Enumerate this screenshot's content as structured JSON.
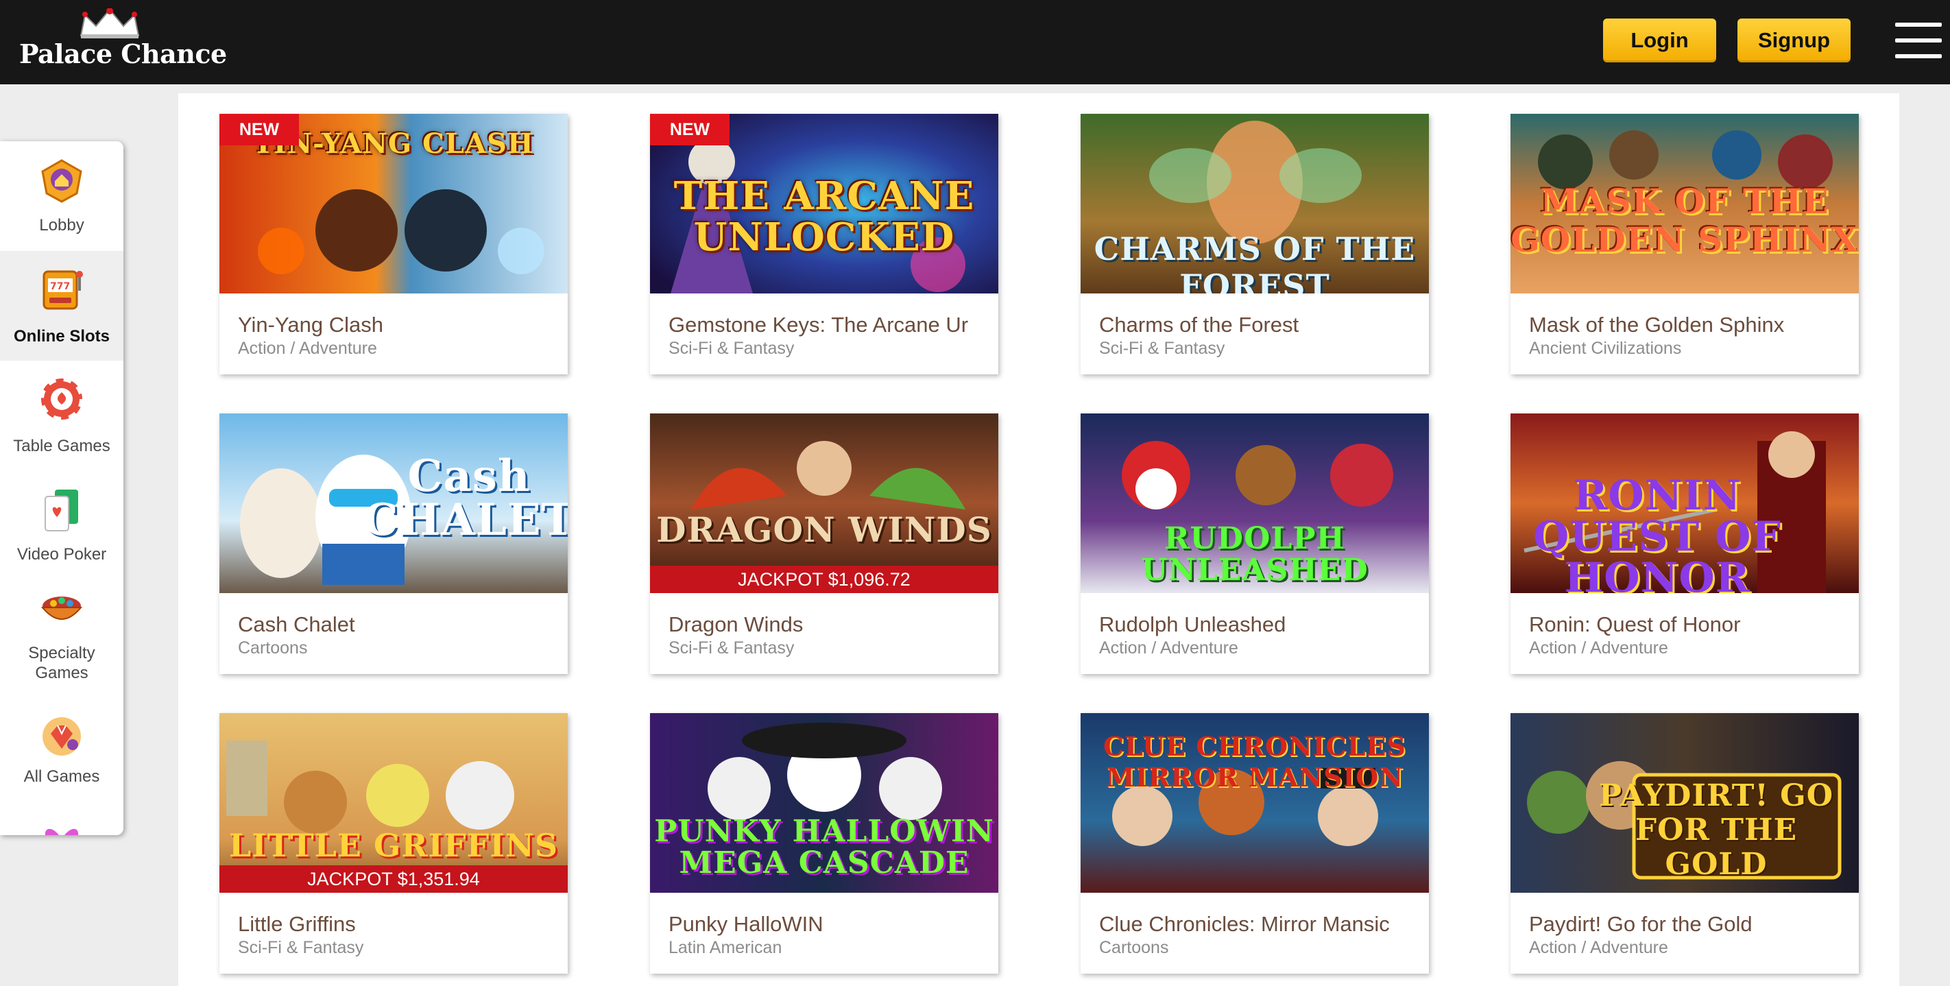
{
  "header": {
    "logo_text": "Palace Chance",
    "login_label": "Login",
    "signup_label": "Signup",
    "menu_icon": "hamburger-icon"
  },
  "sidebar": {
    "items": [
      {
        "label": "Lobby",
        "icon": "lobby-crest-icon",
        "active": false
      },
      {
        "label": "Online Slots",
        "icon": "slot-machine-icon",
        "active": true
      },
      {
        "label": "Table Games",
        "icon": "poker-chip-icon",
        "active": false
      },
      {
        "label": "Video Poker",
        "icon": "playing-cards-icon",
        "active": false
      },
      {
        "label": "Specialty",
        "label2": "Games",
        "icon": "specialty-bowl-icon",
        "active": false
      },
      {
        "label": "All Games",
        "icon": "gems-icon",
        "active": false
      }
    ]
  },
  "games": [
    {
      "name": "Yin-Yang Clash",
      "genre": "Action / Adventure",
      "badge": "NEW",
      "jackpot": null,
      "art_title": "YIN-YANG CLASH"
    },
    {
      "name": "Gemstone Keys: The Arcane Ur",
      "genre": "Sci-Fi & Fantasy",
      "badge": "NEW",
      "jackpot": null,
      "art_title": "THE ARCANE UNLOCKED"
    },
    {
      "name": "Charms of the Forest",
      "genre": "Sci-Fi & Fantasy",
      "badge": null,
      "jackpot": null,
      "art_title": "CHARMS OF THE FOREST"
    },
    {
      "name": "Mask of the Golden Sphinx",
      "genre": "Ancient Civilizations",
      "badge": null,
      "jackpot": null,
      "art_title": "MASK OF THE GOLDEN SPHINX"
    },
    {
      "name": "Cash Chalet",
      "genre": "Cartoons",
      "badge": null,
      "jackpot": null,
      "art_title": "Cash CHALET"
    },
    {
      "name": "Dragon Winds",
      "genre": "Sci-Fi & Fantasy",
      "badge": null,
      "jackpot": "JACKPOT $1,096.72",
      "art_title": "DRAGON WINDS"
    },
    {
      "name": "Rudolph Unleashed",
      "genre": "Action / Adventure",
      "badge": null,
      "jackpot": null,
      "art_title": "RUDOLPH UNLEASHED"
    },
    {
      "name": "Ronin: Quest of Honor",
      "genre": "Action / Adventure",
      "badge": null,
      "jackpot": null,
      "art_title": "RONIN QUEST OF HONOR"
    },
    {
      "name": "Little Griffins",
      "genre": "Sci-Fi & Fantasy",
      "badge": null,
      "jackpot": "JACKPOT $1,351.94",
      "art_title": "LITTLE GRIFFINS"
    },
    {
      "name": "Punky HalloWIN",
      "genre": "Latin American",
      "badge": null,
      "jackpot": null,
      "art_title": "PUNKY HALLOWIN MEGA CASCADE"
    },
    {
      "name": "Clue Chronicles: Mirror Mansic",
      "genre": "Cartoons",
      "badge": null,
      "jackpot": null,
      "art_title": "CLUE CHRONICLES MIRROR MANSION"
    },
    {
      "name": "Paydirt! Go for the Gold",
      "genre": "Action / Adventure",
      "badge": null,
      "jackpot": null,
      "art_title": "PAYDIRT! GO FOR THE GOLD"
    }
  ],
  "colors": {
    "header_bg": "#171717",
    "button_gold": "#ffc21a",
    "badge_red": "#e0141c",
    "jackpot_red": "#c5141b",
    "game_name": "#6b4c3c",
    "game_genre": "#8c8c8c"
  }
}
